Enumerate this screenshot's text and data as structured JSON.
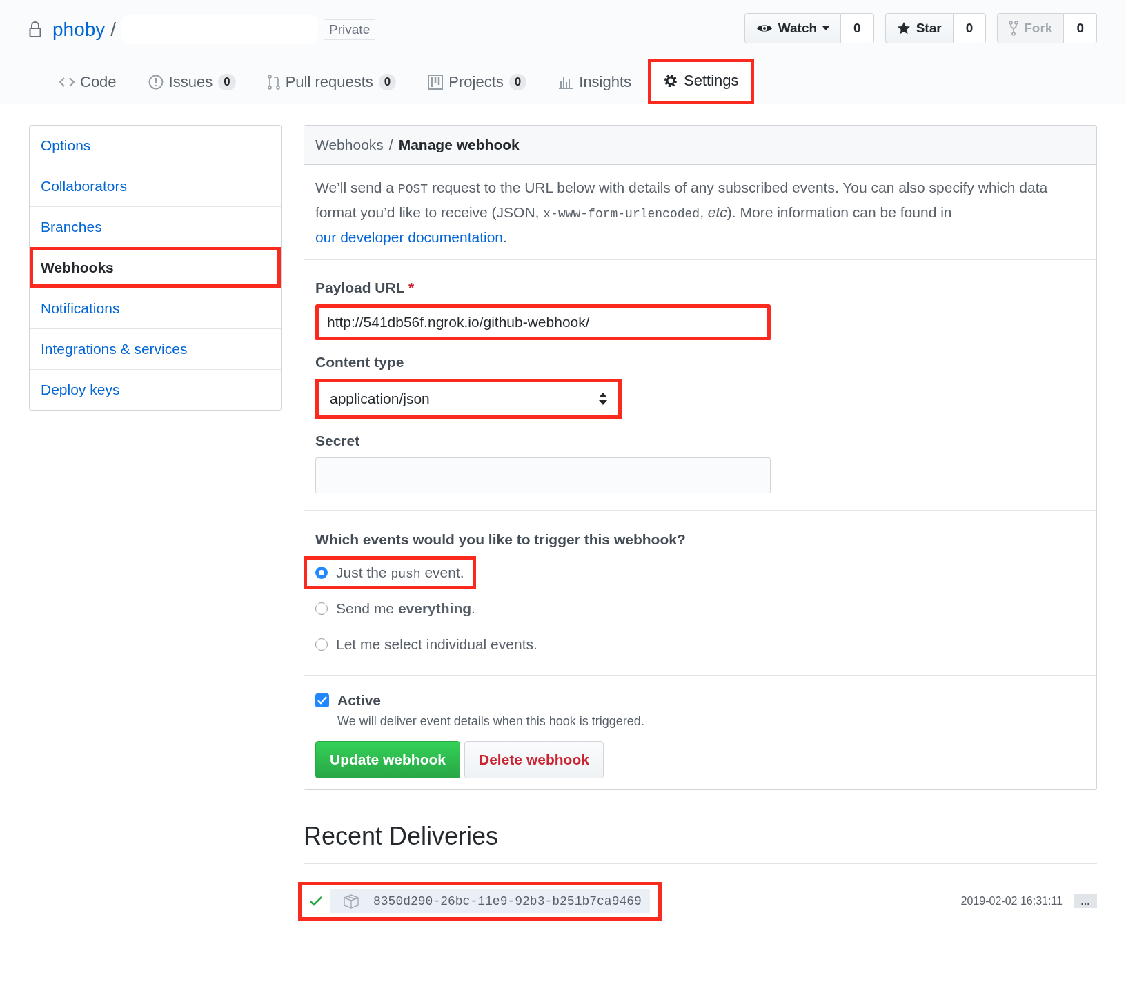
{
  "repo": {
    "owner": "phoby",
    "separator": "/",
    "visibility": "Private"
  },
  "actions": [
    {
      "kind": "watch",
      "label": "Watch",
      "count": "0",
      "disabled": false
    },
    {
      "kind": "star",
      "label": "Star",
      "count": "0",
      "disabled": false
    },
    {
      "kind": "fork",
      "label": "Fork",
      "count": "0",
      "disabled": true
    }
  ],
  "tabs": [
    {
      "kind": "code",
      "label": "Code",
      "selected": false,
      "highlighted": false
    },
    {
      "kind": "issues",
      "label": "Issues",
      "count": "0",
      "selected": false,
      "highlighted": false
    },
    {
      "kind": "pulls",
      "label": "Pull requests",
      "count": "0",
      "selected": false,
      "highlighted": false
    },
    {
      "kind": "projects",
      "label": "Projects",
      "count": "0",
      "selected": false,
      "highlighted": false
    },
    {
      "kind": "insights",
      "label": "Insights",
      "selected": false,
      "highlighted": false
    },
    {
      "kind": "settings",
      "label": "Settings",
      "selected": true,
      "highlighted": true
    }
  ],
  "sidebar": {
    "items": [
      {
        "label": "Options",
        "selected": false,
        "highlighted": false
      },
      {
        "label": "Collaborators",
        "selected": false,
        "highlighted": false
      },
      {
        "label": "Branches",
        "selected": false,
        "highlighted": false
      },
      {
        "label": "Webhooks",
        "selected": true,
        "highlighted": true
      },
      {
        "label": "Notifications",
        "selected": false,
        "highlighted": false
      },
      {
        "label": "Integrations & services",
        "selected": false,
        "highlighted": false
      },
      {
        "label": "Deploy keys",
        "selected": false,
        "highlighted": false
      }
    ]
  },
  "panel": {
    "breadcrumb": {
      "parent": "Webhooks",
      "separator": "/",
      "current": "Manage webhook"
    },
    "intro": [
      {
        "kind": "text",
        "text": "We’ll send a "
      },
      {
        "kind": "code",
        "text": "POST"
      },
      {
        "kind": "text",
        "text": " request to the URL below with details of any subscribed events. You can also specify which data format you’d like to receive (JSON, "
      },
      {
        "kind": "code",
        "text": "x-www-form-urlencoded"
      },
      {
        "kind": "text",
        "text": ", "
      },
      {
        "kind": "em",
        "text": "etc"
      },
      {
        "kind": "text",
        "text": "). More information can be found in "
      },
      {
        "kind": "link",
        "text": "our developer documentation"
      },
      {
        "kind": "text",
        "text": "."
      }
    ],
    "payload_url": {
      "label": "Payload URL",
      "required": "*",
      "value": "http://541db56f.ngrok.io/github-webhook/",
      "highlighted": true
    },
    "content_type": {
      "label": "Content type",
      "value": "application/json",
      "highlighted": true
    },
    "secret": {
      "label": "Secret"
    },
    "events": {
      "question": "Which events would you like to trigger this webhook?",
      "options": [
        {
          "parts": [
            {
              "kind": "text",
              "text": "Just the "
            },
            {
              "kind": "code",
              "text": "push"
            },
            {
              "kind": "text",
              "text": " event."
            }
          ],
          "selected": true,
          "highlighted": true
        },
        {
          "parts": [
            {
              "kind": "text",
              "text": "Send me "
            },
            {
              "kind": "strong",
              "text": "everything"
            },
            {
              "kind": "text",
              "text": "."
            }
          ],
          "selected": false,
          "highlighted": false
        },
        {
          "parts": [
            {
              "kind": "text",
              "text": "Let me select individual events."
            }
          ],
          "selected": false,
          "highlighted": false
        }
      ]
    },
    "active": {
      "label": "Active",
      "hint": "We will deliver event details when this hook is triggered.",
      "checked": true
    },
    "buttons": [
      {
        "kind": "primary",
        "label": "Update webhook"
      },
      {
        "kind": "danger",
        "label": "Delete webhook"
      }
    ]
  },
  "recent": {
    "title": "Recent Deliveries",
    "deliveries": [
      {
        "succeeded": true,
        "guid": "8350d290-26bc-11e9-92b3-b251b7ca9469",
        "time": "2019-02-02 16:31:11",
        "more": "…",
        "highlighted": true
      }
    ]
  }
}
